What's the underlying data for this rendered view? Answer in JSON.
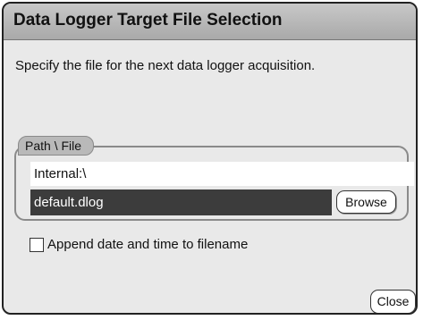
{
  "dialog": {
    "title": "Data Logger Target File Selection",
    "instructions": "Specify the file for the next data logger acquisition."
  },
  "path_group": {
    "label": "Path \\ File",
    "path_value": "Internal:\\",
    "file_value": "default.dlog",
    "browse_label": "Browse"
  },
  "append_option": {
    "label": "Append date and time to filename",
    "checked": false
  },
  "footer": {
    "close_label": "Close"
  },
  "colors": {
    "title_bar": "#b5b5b5",
    "dialog_background": "#e9e9e9",
    "selected_field": "#3c3c3c",
    "border": "#222222"
  }
}
